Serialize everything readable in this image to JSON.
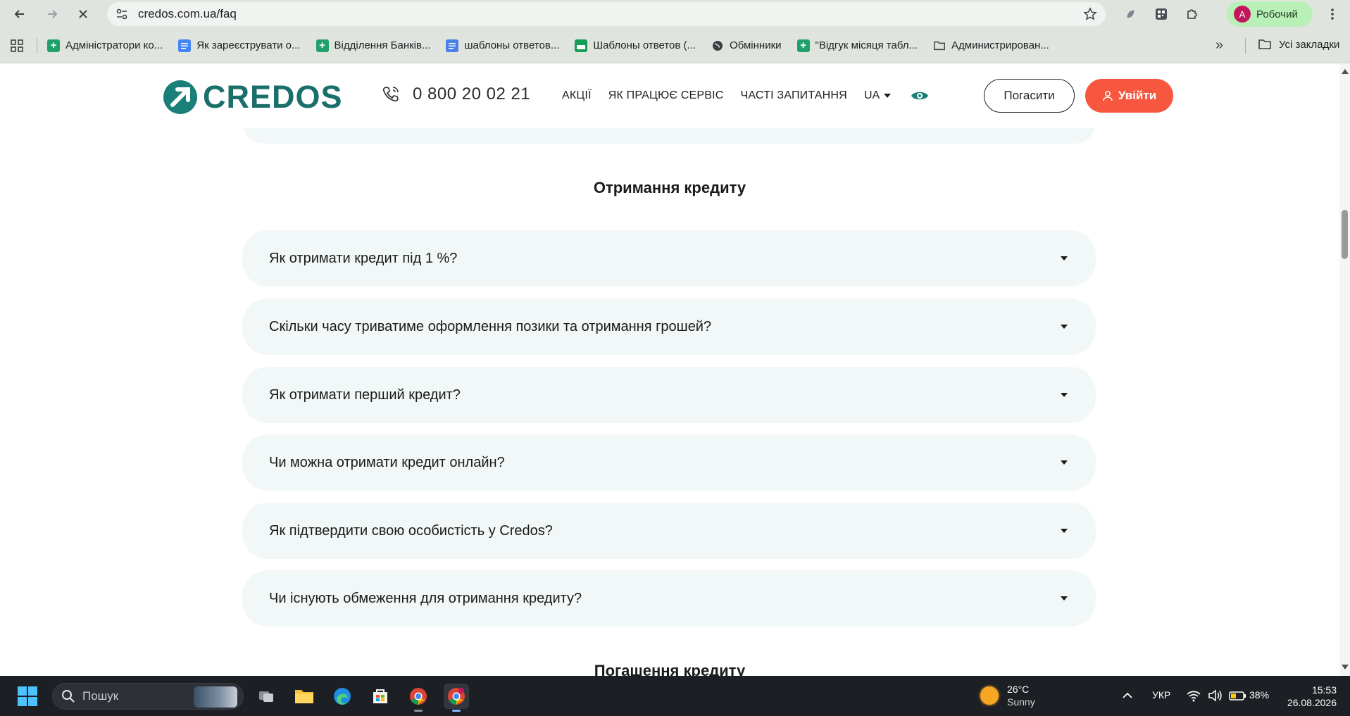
{
  "browser": {
    "url": "credos.com.ua/faq",
    "profile_initial": "A",
    "profile_name": "Робочий",
    "bookmarks": [
      {
        "label": "Адміністратори ко...",
        "icon": "sheets-icon"
      },
      {
        "label": "Як зареєструвати о...",
        "icon": "docs-icon"
      },
      {
        "label": "Відділення Банків...",
        "icon": "sheets-icon"
      },
      {
        "label": "шаблоны ответов...",
        "icon": "docs-icon"
      },
      {
        "label": "Шаблоны ответов (...",
        "icon": "slides-icon"
      },
      {
        "label": "Обмінники",
        "icon": "globe-icon"
      },
      {
        "label": "\"Відгук місяця табл...",
        "icon": "sheets-icon"
      },
      {
        "label": "Администрирован...",
        "icon": "folder-icon"
      }
    ],
    "all_bookmarks": "Усі закладки"
  },
  "site": {
    "logo_text": "CREDOS",
    "phone": "0 800 20 02 21",
    "nav": [
      "АКЦІЇ",
      "ЯК ПРАЦЮЄ СЕРВІС",
      "ЧАСТІ ЗАПИТАННЯ"
    ],
    "lang": "UA",
    "repay_button": "Погасити",
    "login_button": "Увійти"
  },
  "faq": {
    "section_title": "Отримання кредиту",
    "questions": [
      "Як отримати кредит під 1 %?",
      "Скільки часу триватиме оформлення позики та отримання грошей?",
      "Як отримати перший кредит?",
      "Чи можна отримати кредит онлайн?",
      "Як підтвердити свою особистість у Credos?",
      "Чи існують обмеження для отримання кредиту?"
    ],
    "next_section_title": "Погашення кредиту"
  },
  "taskbar": {
    "search_placeholder": "Пошук",
    "weather_temp": "26°C",
    "weather_cond": "Sunny",
    "lang": "УКР",
    "battery": "38%",
    "time": "15:53",
    "date": "26.08.2026"
  },
  "colors": {
    "brand_teal": "#1a7f78",
    "login_orange": "#f7573f",
    "faq_bg": "#f2f8f7"
  }
}
